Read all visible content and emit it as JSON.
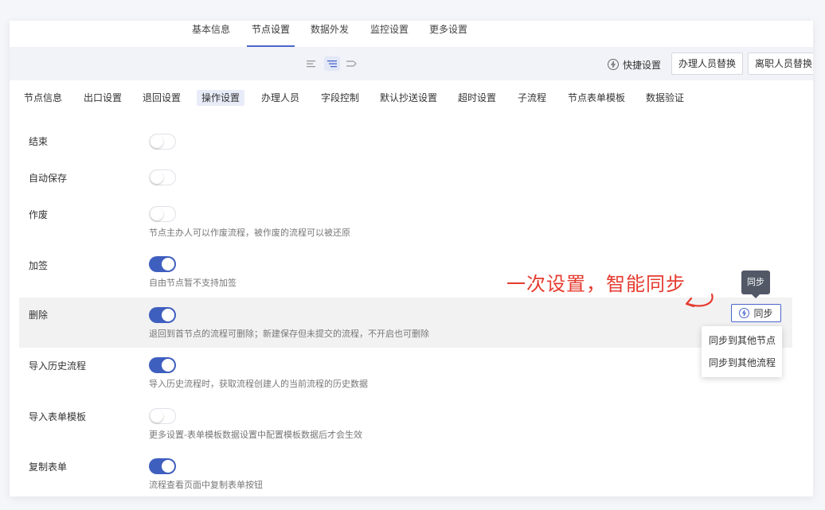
{
  "top_tabs": [
    "基本信息",
    "节点设置",
    "数据外发",
    "监控设置",
    "更多设置"
  ],
  "toolbar": {
    "quick_settings": "快捷设置",
    "replace_handler": "办理人员替换",
    "replace_departed": "离职人员替换"
  },
  "sub_tabs": [
    "节点信息",
    "出口设置",
    "退回设置",
    "操作设置",
    "办理人员",
    "字段控制",
    "默认抄送设置",
    "超时设置",
    "子流程",
    "节点表单模板",
    "数据验证"
  ],
  "settings": [
    {
      "label": "结束",
      "on": false,
      "desc": ""
    },
    {
      "label": "自动保存",
      "on": false,
      "desc": ""
    },
    {
      "label": "作废",
      "on": false,
      "desc": "节点主办人可以作废流程，被作废的流程可以被还原"
    },
    {
      "label": "加签",
      "on": true,
      "desc": "自由节点暂不支持加签"
    },
    {
      "label": "删除",
      "on": true,
      "desc": "退回到首节点的流程可删除；新建保存但未提交的流程，不开启也可删除"
    },
    {
      "label": "导入历史流程",
      "on": true,
      "desc": "导入历史流程时，获取流程创建人的当前流程的历史数据"
    },
    {
      "label": "导入表单模板",
      "on": false,
      "desc": "更多设置-表单模板数据设置中配置模板数据后才会生效"
    },
    {
      "label": "复制表单",
      "on": true,
      "desc": "流程查看页面中复制表单按钮"
    }
  ],
  "annotation": "一次设置，智能同步",
  "sync": {
    "tooltip": "同步",
    "button": "同步",
    "menu": [
      "同步到其他节点",
      "同步到其他流程"
    ]
  },
  "colors": {
    "accent": "#3f5fbf",
    "annotation": "#e53b2f"
  }
}
